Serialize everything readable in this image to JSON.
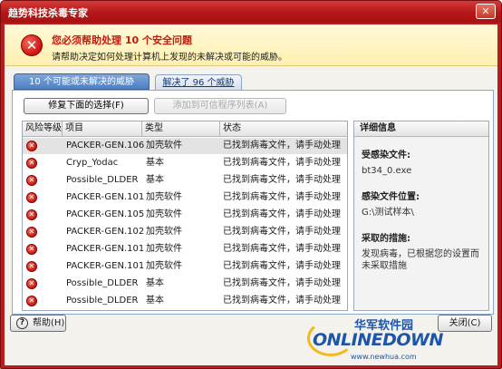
{
  "window": {
    "title": "趋势科技杀毒专家",
    "close_glyph": "✕"
  },
  "header": {
    "title": "您必须帮助处理 10 个安全问题",
    "subtitle": "请帮助决定如何处理计算机上发现的未解决或可能的威胁。",
    "icon": "error-x-icon"
  },
  "tabs": [
    {
      "label": "10 个可能或未解决的威胁",
      "active": true
    },
    {
      "label": "解决了 96 个威胁",
      "active": false
    }
  ],
  "toolbar": {
    "fix_label": "修复下面的选择(F)",
    "add_label": "添加到可信程序列表(A)"
  },
  "table": {
    "headers": {
      "level": "风险等级",
      "name": "项目",
      "type": "类型",
      "state": "状态"
    },
    "rows": [
      {
        "name": "PACKER-GEN.106",
        "type": "加壳软件",
        "state": "已找到病毒文件，请手动处理"
      },
      {
        "name": "Cryp_Yodac",
        "type": "基本",
        "state": "已找到病毒文件，请手动处理"
      },
      {
        "name": "Possible_DLDER",
        "type": "基本",
        "state": "已找到病毒文件，请手动处理"
      },
      {
        "name": "PACKER-GEN.101",
        "type": "加壳软件",
        "state": "已找到病毒文件，请手动处理"
      },
      {
        "name": "PACKER-GEN.105",
        "type": "加壳软件",
        "state": "已找到病毒文件，请手动处理"
      },
      {
        "name": "PACKER-GEN.102",
        "type": "加壳软件",
        "state": "已找到病毒文件，请手动处理"
      },
      {
        "name": "PACKER-GEN.101",
        "type": "加壳软件",
        "state": "已找到病毒文件，请手动处理"
      },
      {
        "name": "PACKER-GEN.101",
        "type": "加壳软件",
        "state": "已找到病毒文件，请手动处理"
      },
      {
        "name": "Possible_DLDER",
        "type": "基本",
        "state": "已找到病毒文件，请手动处理"
      },
      {
        "name": "Possible_DLDER",
        "type": "基本",
        "state": "已找到病毒文件，请手动处理"
      }
    ]
  },
  "details": {
    "heading": "详细信息",
    "file_label": "受感染文件:",
    "file_value": "bt34_0.exe",
    "location_label": "感染文件位置:",
    "location_value": "G:\\测试样本\\",
    "action_label": "采取的措施:",
    "action_value": "发现病毒，已根据您的设置而未采取措施"
  },
  "footer": {
    "help_label": "帮助(H)",
    "close_label": "关闭(C)",
    "help_icon": "question-icon"
  },
  "watermark": {
    "cn": "华军软件园",
    "en": "ONLINEDOWN",
    "url": "www.newhua.com"
  },
  "colors": {
    "title_red": "#b81c1c",
    "accent_blue": "#4f7fc2",
    "header_yellow": "#fff0b0"
  }
}
